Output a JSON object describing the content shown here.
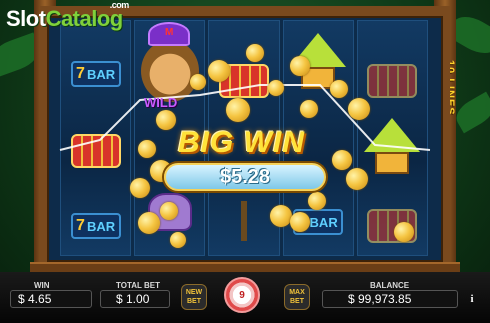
{
  "logo": {
    "slot": "Slot",
    "catalog": "Catalog",
    "com": ".com"
  },
  "paylines_label": "10 LINES",
  "reel_text": {
    "bar": "BAR",
    "bar_num": "7",
    "wild": "WILD",
    "hat_letter": "M",
    "bag_sign": "$"
  },
  "win_banner": {
    "title": "BIG WIN",
    "amount": "$5.28"
  },
  "bottom_bar": {
    "win_label": "WIN",
    "win_value": "$ 4.65",
    "total_bet_label": "TOTAL BET",
    "total_bet_value": "$ 1.00",
    "new_bet_label": "NEW BET",
    "spin_count": "9",
    "max_bet_label": "MAX BET",
    "balance_label": "BALANCE",
    "balance_value": "$ 99,973.85",
    "info_icon": "i"
  },
  "colors": {
    "gold": "#ffe23a",
    "wood": "#7a4a1e",
    "accent_green": "#7fd13b",
    "spin_red": "#e04a4a"
  }
}
